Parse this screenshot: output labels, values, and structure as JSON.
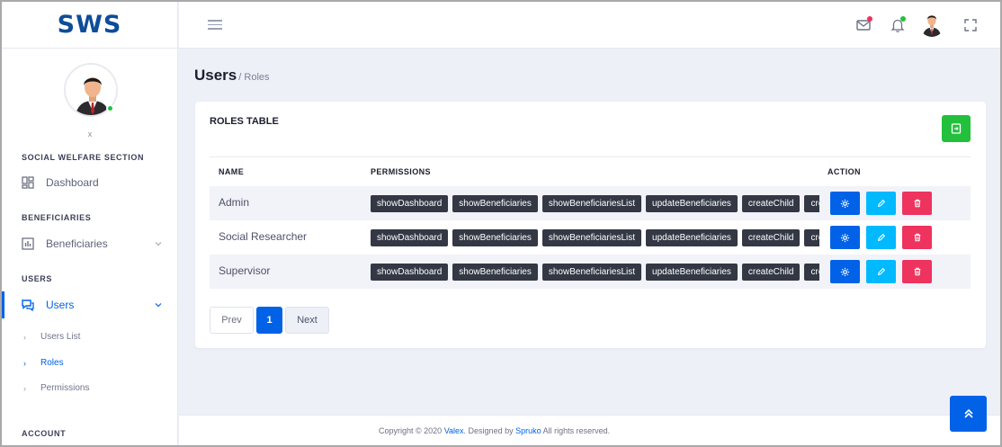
{
  "brand": {
    "logo_text": "SWS",
    "accent": "#0162e8",
    "logo_color": "#0d4d99"
  },
  "sidebar": {
    "profile_name": "x",
    "sections": [
      {
        "title": "SOCIAL WELFARE SECTION"
      },
      {
        "title": "BENEFICIARIES"
      },
      {
        "title": "USERS"
      },
      {
        "title": "ACCOUNT"
      }
    ],
    "items": [
      {
        "label": "Dashboard",
        "icon": "dashboard-icon"
      },
      {
        "label": "Beneficiaries",
        "icon": "chart-icon",
        "expanded": false
      },
      {
        "label": "Users",
        "icon": "users-chat-icon",
        "expanded": true,
        "active": true
      }
    ],
    "sub_items": [
      {
        "label": "Users List",
        "active": false
      },
      {
        "label": "Roles",
        "active": true
      },
      {
        "label": "Permissions",
        "active": false
      }
    ]
  },
  "header": {
    "icons": [
      "menu-icon",
      "mail-icon",
      "bell-icon",
      "avatar",
      "fullscreen-icon"
    ],
    "mail_badge_color": "#ee335e",
    "bell_badge_color": "#22c03c"
  },
  "breadcrumb": {
    "title": "Users",
    "current": "/ Roles"
  },
  "card": {
    "title": "ROLES TABLE",
    "export_icon": "file-export-icon",
    "columns": [
      "NAME",
      "PERMISSIONS",
      "ACTION"
    ],
    "rows": [
      {
        "name": "Admin",
        "permissions": [
          "showDashboard",
          "showBeneficiaries",
          "showBeneficiariesList",
          "updateBeneficiaries",
          "createChild",
          "crea"
        ]
      },
      {
        "name": "Social Researcher",
        "permissions": [
          "showDashboard",
          "showBeneficiaries",
          "showBeneficiariesList",
          "updateBeneficiaries",
          "createChild",
          "crea"
        ]
      },
      {
        "name": "Supervisor",
        "permissions": [
          "showDashboard",
          "showBeneficiaries",
          "showBeneficiariesList",
          "updateBeneficiaries",
          "createChild",
          "crea"
        ]
      }
    ],
    "row_actions": [
      {
        "icon": "gear-icon",
        "color": "#0162e8"
      },
      {
        "icon": "pencil-icon",
        "color": "#00b9ff"
      },
      {
        "icon": "trash-icon",
        "color": "#ee335e"
      }
    ]
  },
  "pagination": {
    "prev": "Prev",
    "current": "1",
    "next": "Next"
  },
  "footer": {
    "prefix": "Copyright © 2020 ",
    "brand": "Valex",
    "middle": ". Designed by ",
    "designer": "Spruko",
    "suffix": " All rights reserved."
  },
  "scroll_top_icon": "chevron-double-up-icon"
}
